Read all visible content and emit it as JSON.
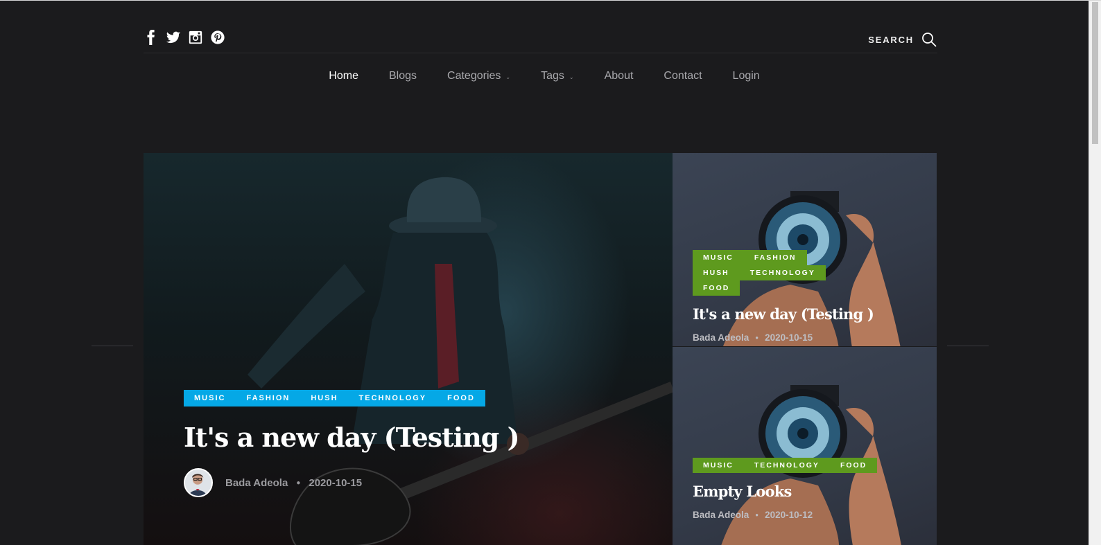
{
  "social": [
    "facebook-icon",
    "twitter-icon",
    "instagram-icon",
    "pinterest-icon"
  ],
  "search": {
    "label": "SEARCH",
    "icon": "search-icon"
  },
  "nav": {
    "items": [
      {
        "label": "Home",
        "active": true
      },
      {
        "label": "Blogs"
      },
      {
        "label": "Categories",
        "dropdown": true
      },
      {
        "label": "Tags",
        "dropdown": true
      },
      {
        "label": "About"
      },
      {
        "label": "Contact"
      },
      {
        "label": "Login"
      }
    ]
  },
  "featured": {
    "tags": [
      "MUSIC",
      "FASHION",
      "HUSH",
      "TECHNOLOGY",
      "FOOD"
    ],
    "title": "It's a new day (Testing )",
    "author": "Bada Adeola",
    "date": "2020-10-15"
  },
  "cards": [
    {
      "tags": [
        "MUSIC",
        "FASHION",
        "HUSH",
        "TECHNOLOGY",
        "FOOD"
      ],
      "title": "It's a new day (Testing )",
      "author": "Bada Adeola",
      "date": "2020-10-15"
    },
    {
      "tags": [
        "MUSIC",
        "TECHNOLOGY",
        "FOOD"
      ],
      "title": "Empty Looks",
      "author": "Bada Adeola",
      "date": "2020-10-12"
    }
  ],
  "colors": {
    "background": "#1b1b1d",
    "tag_blue": "#05a8e6",
    "tag_green": "#5e9a1e"
  }
}
